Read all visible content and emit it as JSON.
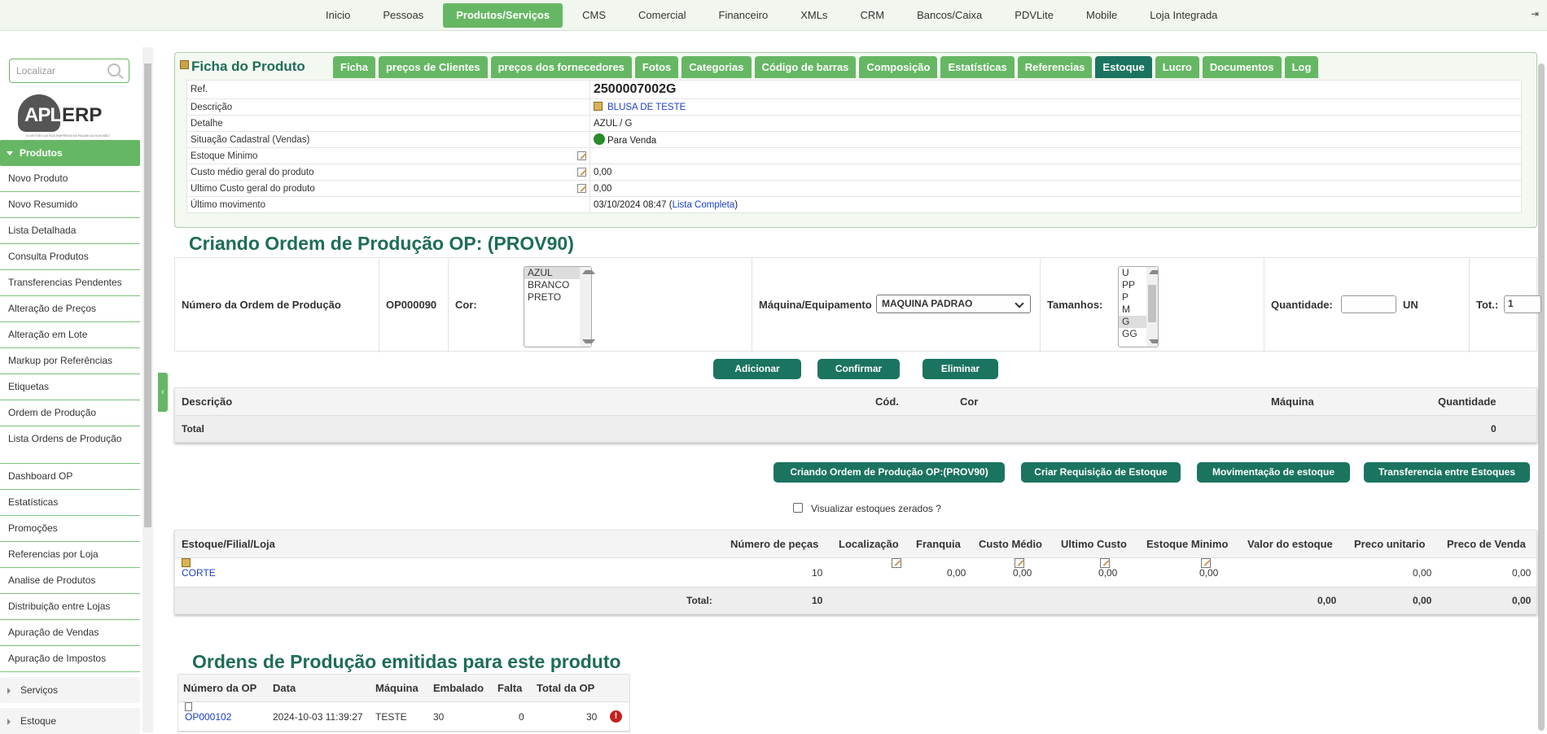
{
  "topnav": [
    "Inicio",
    "Pessoas",
    "Produtos/Serviços",
    "CMS",
    "Comercial",
    "Financeiro",
    "XMLs",
    "CRM",
    "Bancos/Caixa",
    "PDVLite",
    "Mobile",
    "Loja Integrada"
  ],
  "topnav_active": "Produtos/Serviços",
  "search": {
    "placeholder": "Localizar"
  },
  "logo": {
    "left": "APL",
    "right": "ERP",
    "tagline": "A GESTÃO DA SUA EMPRESA NA PALMA DA SUA MÃO"
  },
  "menu": {
    "header": "Produtos",
    "items": [
      "Novo Produto",
      "Novo Resumido",
      "Lista Detalhada",
      "Consulta Produtos",
      "Transferencias Pendentes",
      "Alteração de Preços",
      "Alteração em Lote",
      "Markup por Referências",
      "Etiquetas",
      "Ordem de Produção",
      "Lista Ordens de Produção",
      "Dashboard OP",
      "Estatísticas",
      "Promoções",
      "Referencias por Loja",
      "Analise de Produtos",
      "Distribuição entre Lojas",
      "Apuração de Vendas",
      "Apuração de Impostos"
    ],
    "collapsed": [
      "Serviços",
      "Estoque"
    ]
  },
  "ficha": {
    "title": "Ficha do Produto",
    "tabs": [
      "Ficha",
      "preços de Clientes",
      "preços dos fornecedores",
      "Fotos",
      "Categorias",
      "Código de barras",
      "Composição",
      "Estatísticas",
      "Referencias",
      "Estoque",
      "Lucro",
      "Documentos",
      "Log"
    ],
    "active_tab": "Estoque",
    "ref_label": "Ref.",
    "ref_value": "2500007002G",
    "desc_label": "Descrição",
    "desc_value": "BLUSA DE TESTE",
    "detail_label": "Detalhe",
    "detail_value": "AZUL / G",
    "situacao_label": "Situação Cadastral (Vendas)",
    "situacao_value": "Para Venda",
    "situacao_color": "#2b8a2b",
    "estoque_min_label": "Estoque Minimo",
    "estoque_min_value": "",
    "custo_medio_label": "Custo médio geral do produto",
    "custo_medio_value": "0,00",
    "ultimo_custo_label": "Ultimo Custo geral do produto",
    "ultimo_custo_value": "0,00",
    "ultimo_mov_label": "Último movimento",
    "ultimo_mov_value": "03/10/2024 08:47 (",
    "ultimo_mov_link": "Lista Completa",
    "ultimo_mov_close": ")"
  },
  "op": {
    "title": "Criando Ordem de Produção OP: (PROV90)",
    "numero_label": "Número da Ordem de Produção",
    "numero_value": "OP000090",
    "cor_label": "Cor:",
    "cores": [
      "AZUL",
      "BRANCO",
      "PRETO"
    ],
    "cor_selected": "AZUL",
    "maquina_label": "Máquina/Equipamento",
    "maquina_value": "MAQUINA PADRAO",
    "tamanhos_label": "Tamanhos:",
    "tamanhos": [
      "U",
      "PP",
      "P",
      "M",
      "G",
      "GG"
    ],
    "tamanho_selected": "G",
    "quantidade_label": "Quantidade:",
    "quantidade_value": "",
    "unidade": "UN",
    "tot_label": "Tot.:",
    "tot_value": "1",
    "buttons": {
      "adicionar": "Adicionar",
      "confirmar": "Confirmar",
      "eliminar": "Eliminar"
    },
    "table_headers": {
      "descricao": "Descrição",
      "cod": "Cód.",
      "cor": "Cor",
      "maquina": "Máquina",
      "quantidade": "Quantidade"
    },
    "total_label": "Total",
    "total_value": "0"
  },
  "actions": [
    "Criando Ordem de Produção OP:(PROV90)",
    "Criar Requisição de Estoque",
    "Movimentação de estoque",
    "Transferencia entre Estoques"
  ],
  "zero_label": "Visualizar estoques zerados ?",
  "stock": {
    "headers": [
      "Estoque/Filial/Loja",
      "Número de peças",
      "Localização",
      "Franquia",
      "Custo Médio",
      "Ultimo Custo",
      "Estoque Minimo",
      "Valor do estoque",
      "Preco unitario",
      "Preco de Venda"
    ],
    "row": {
      "name": "CORTE",
      "pecas": "10",
      "franquia": "0,00",
      "custo_medio": "0,00",
      "ultimo_custo": "0,00",
      "estoque_min": "0,00",
      "preco_unit": "0,00",
      "preco_venda": "0,00"
    },
    "total_label": "Total:",
    "total_pecas": "10",
    "total_valor": "0,00",
    "total_unit": "0,00",
    "total_venda": "0,00"
  },
  "emitidas": {
    "title": "Ordens de Produção emitidas para este produto",
    "headers": [
      "Número da OP",
      "Data",
      "Máquina",
      "Embalado",
      "Falta",
      "Total da OP"
    ],
    "rows": [
      {
        "numero": "OP000102",
        "data": "2024-10-03 11:39:27",
        "maquina": "TESTE",
        "embalado": "30",
        "falta": "0",
        "total": "30",
        "flag": "!"
      }
    ]
  }
}
